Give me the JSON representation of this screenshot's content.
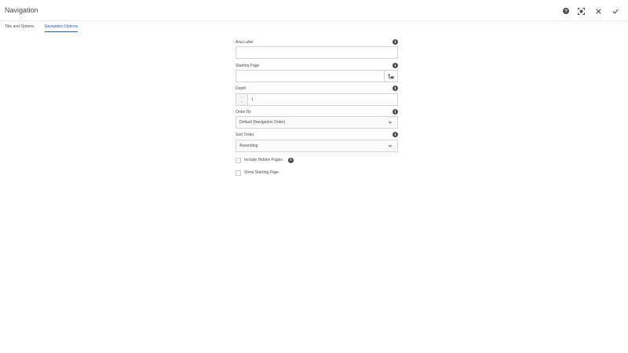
{
  "header": {
    "title": "Navigation",
    "help_icon": "help-icon",
    "fullscreen_icon": "fullscreen-icon",
    "cancel_icon": "close-icon",
    "done_icon": "checkmark-icon"
  },
  "tabs": [
    {
      "label": "Title and Options"
    },
    {
      "label": "Navigation Options"
    }
  ],
  "fields": {
    "aria_label": {
      "label": "Aria Label",
      "value": ""
    },
    "starting_page": {
      "label": "Starting Page",
      "value": ""
    },
    "depth": {
      "label": "Depth",
      "value": "1"
    },
    "order_by": {
      "label": "Order By",
      "selected": "Default (Navigation Order)"
    },
    "sort_order": {
      "label": "Sort Order",
      "selected": "Ascending"
    },
    "include_hidden": {
      "label": "Include Hidden Pages",
      "checked": false
    },
    "show_starting": {
      "label": "Show Starting Page",
      "checked": false
    }
  },
  "info_glyph": "i",
  "stepper": {
    "up": "^",
    "down": "v"
  },
  "colors": {
    "accent": "#2d5fa8",
    "text": "#4b4b4b",
    "border": "#d3d3d3"
  }
}
